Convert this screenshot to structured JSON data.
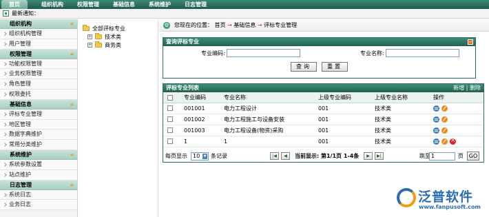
{
  "top_nav": [
    "首页",
    "组织机构",
    "权限管理",
    "基础信息",
    "系统维护",
    "日志管理"
  ],
  "notice": "最新通知：",
  "sidebar": [
    {
      "title": "组织机构",
      "items": [
        "组织机构管理",
        "用户管理"
      ]
    },
    {
      "title": "权限管理",
      "items": [
        "功能权限管理",
        "业务权限管理",
        "角色管理",
        "权限委托"
      ]
    },
    {
      "title": "基础信息",
      "items": [
        "评标专业管理",
        "地区管理",
        "数据字典维护",
        "常用分类维护"
      ]
    },
    {
      "title": "系统维护",
      "items": [
        "系统参数设置",
        "站点维护"
      ]
    },
    {
      "title": "日志管理",
      "items": [
        "系统日志",
        "业务日志"
      ]
    }
  ],
  "tree": {
    "root": "全部评标专业",
    "children": [
      "技术类",
      "商务类"
    ]
  },
  "breadcrumb": {
    "prefix": "您现在的位置：",
    "parts": [
      "首页",
      "基础信息",
      "评标专业管理"
    ]
  },
  "query": {
    "title": "查询评标专业",
    "code_label": "专业编码:",
    "name_label": "专业名称:",
    "search_btn": "查询",
    "reset_btn": "重置"
  },
  "list": {
    "title": "评标专业列表",
    "actions": [
      "新增",
      "删除"
    ],
    "columns": [
      "专业编码",
      "专业名称",
      "上级专业编码",
      "上级专业名称",
      "操作"
    ],
    "rows": [
      {
        "code": "001001",
        "name": "电力工程设计",
        "parent_code": "001",
        "parent_name": "技术类",
        "del": false
      },
      {
        "code": "001002",
        "name": "电力工程施工与设备安装",
        "parent_code": "001",
        "parent_name": "技术类",
        "del": false
      },
      {
        "code": "001003",
        "name": "电力工程设备(物资)采购",
        "parent_code": "001",
        "parent_name": "技术类",
        "del": false
      },
      {
        "code": "1",
        "name": "1",
        "parent_code": "001",
        "parent_name": "技术类",
        "del": true
      }
    ]
  },
  "pager": {
    "per_page_label": "每页显示",
    "per_page": "10",
    "records_label": "条记录",
    "status": "当前显示: 第1/1页 1-4条",
    "goto_label": "跳至",
    "page_value": "1",
    "page_unit": "页",
    "go": "GO"
  },
  "logo": {
    "name": "泛普软件",
    "url": "www.fanpusoft.com"
  },
  "colors": {
    "header": "#23604f",
    "accent": "#f08a1c"
  }
}
